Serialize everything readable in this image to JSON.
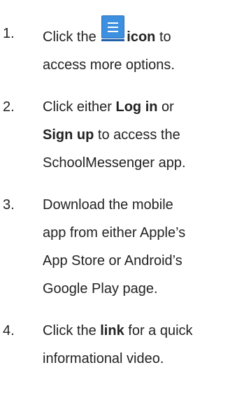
{
  "steps": [
    {
      "number": "1.",
      "before_icon": "Click the",
      "icon": "menu-icon",
      "bold": "icon",
      "after_bold": " to",
      "line2": "access more options."
    },
    {
      "number": "2.",
      "line1_text": "Click either ",
      "line1_bold": "Log in",
      "line1_after": " or",
      "line2_bold": "Sign up",
      "line2_after": " to access the",
      "line3": "SchoolMessenger app."
    },
    {
      "number": "3.",
      "lines": [
        "Download the mobile",
        "app from either Apple’s",
        "App Store or Android’s",
        "Google Play page."
      ]
    },
    {
      "number": "4.",
      "line1_text": "Click the ",
      "line1_bold": "link",
      "line1_after": " for a quick",
      "line2": "informational video."
    }
  ],
  "colors": {
    "text": "#222222",
    "icon_blue": "#3d8fe0"
  }
}
